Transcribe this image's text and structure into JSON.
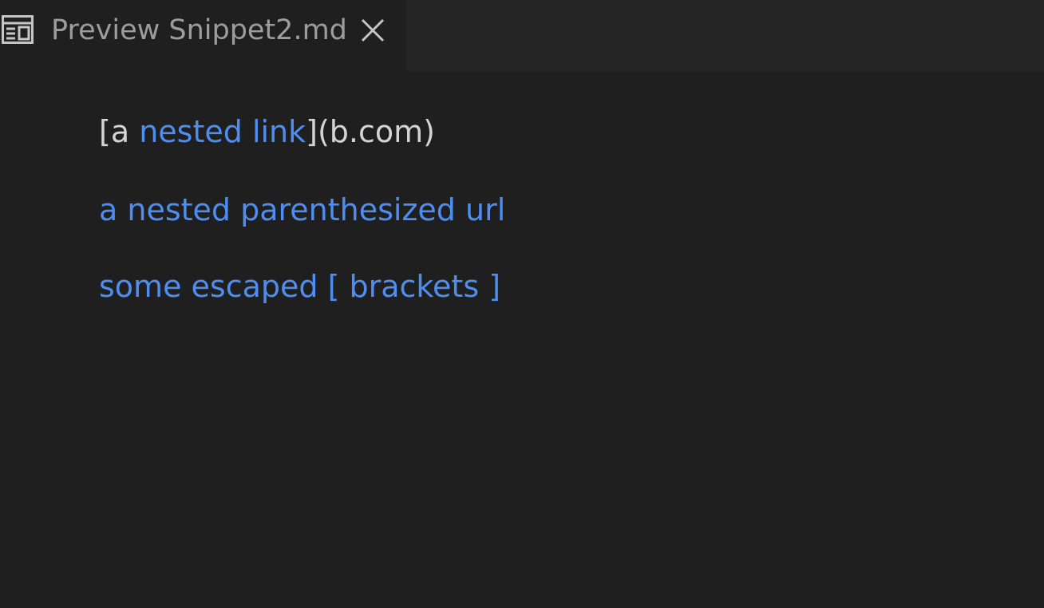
{
  "tab": {
    "icon": "preview-icon",
    "title": "Preview Snippet2.md",
    "close_icon": "close-icon"
  },
  "preview": {
    "line1": {
      "prefix": "[a ",
      "link_text": "nested link",
      "suffix": "](b.com)"
    },
    "line2": {
      "link_text": "a nested parenthesized url"
    },
    "line3": {
      "link_text": "some escaped [ brackets ]"
    }
  },
  "colors": {
    "background": "#1f1f1f",
    "tabbar": "#252526",
    "text": "#d4d4d4",
    "link": "#4d8ef0",
    "tab_title": "#9d9d9d"
  }
}
